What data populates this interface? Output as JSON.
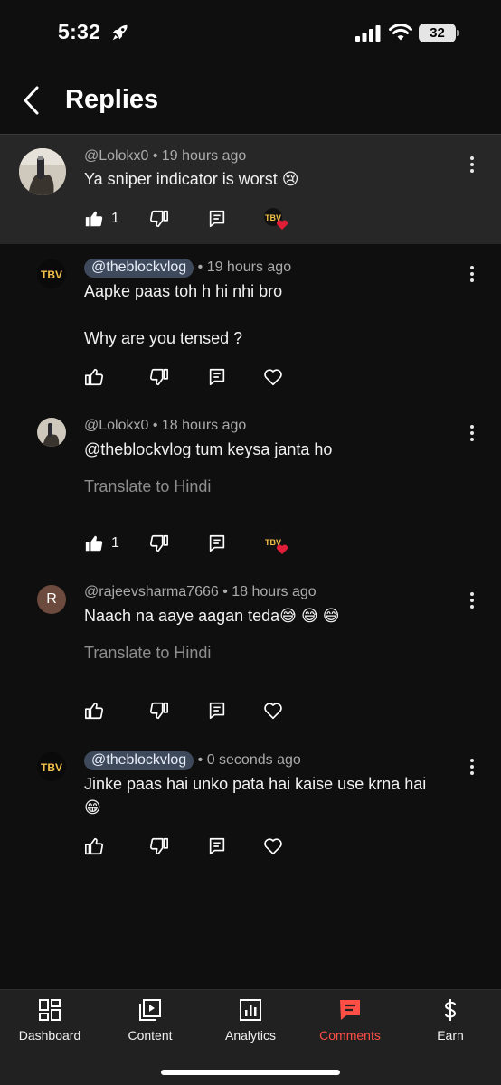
{
  "status_bar": {
    "time": "5:32",
    "battery": "32"
  },
  "header": {
    "title": "Replies"
  },
  "parent_comment": {
    "handle": "@Lolokx0",
    "time": "19 hours ago",
    "text": "Ya sniper indicator is worst 😢",
    "likes": "1"
  },
  "replies": [
    {
      "handle": "@theblockvlog",
      "time": "19 hours ago",
      "text": "Aapke paas toh h hi nhi bro\n\nWhy are you tensed ?"
    },
    {
      "handle": "@Lolokx0",
      "time": "18 hours ago",
      "text": "@theblockvlog  tum keysa janta ho",
      "translate": "Translate to Hindi",
      "likes": "1"
    },
    {
      "handle": "@rajeevsharma7666",
      "time": "18 hours ago",
      "text": "Naach na aaye aagan teda😅 😅 😅",
      "translate": "Translate to Hindi",
      "avatar_letter": "R"
    },
    {
      "handle": "@theblockvlog",
      "time": "0 seconds ago",
      "text": "Jinke paas hai unko pata hai kaise use krna hai\n😁"
    }
  ],
  "bottom_nav": {
    "items": [
      {
        "label": "Dashboard",
        "icon": "dashboard-icon"
      },
      {
        "label": "Content",
        "icon": "content-icon"
      },
      {
        "label": "Analytics",
        "icon": "analytics-icon"
      },
      {
        "label": "Comments",
        "icon": "comments-icon"
      },
      {
        "label": "Earn",
        "icon": "earn-icon"
      }
    ],
    "active": "Comments"
  },
  "colors": {
    "background": "#0f0f0f",
    "highlight": "#272727",
    "accent": "#ff4e45",
    "chip": "#3e4a5c"
  }
}
